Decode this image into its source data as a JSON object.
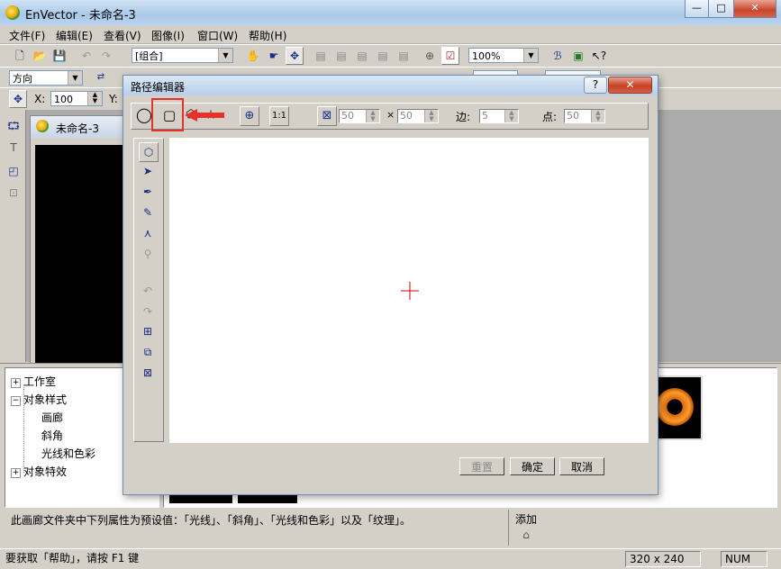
{
  "window": {
    "title": "EnVector - 未命名-3",
    "minimize": "—",
    "maximize": "□",
    "close": "✕"
  },
  "menu": [
    "文件(F)",
    "编辑(E)",
    "查看(V)",
    "图像(I)",
    "窗口(W)",
    "帮助(H)"
  ],
  "toolbar": {
    "group_combo": "[组合]",
    "zoom_combo": "100%",
    "direction_combo": "方向",
    "x_label": "X:",
    "x_value": "100",
    "y_label": "Y:"
  },
  "document": {
    "tab_title": "未命名-3"
  },
  "tree": {
    "items": [
      {
        "label": "工作室",
        "expander": "+"
      },
      {
        "label": "对象样式",
        "expander": "−"
      },
      {
        "label": "画廊"
      },
      {
        "label": "斜角"
      },
      {
        "label": "光线和色彩"
      },
      {
        "label": "对象特效",
        "expander": "+"
      }
    ]
  },
  "info": {
    "description": "此画廊文件夹中下列属性为预设值：「光线」、「斜角」、「光线和色彩」以及「纹理」。",
    "add_label": "添加"
  },
  "dialog": {
    "title": "路径编辑器",
    "help_label": "?",
    "close_label": "✕",
    "width_value": "50",
    "times_label": "×",
    "height_value": "50",
    "sides_label": "边:",
    "sides_value": "5",
    "points_label": "点:",
    "points_value": "50",
    "reset_button": "重置",
    "ok_button": "确定",
    "cancel_button": "取消",
    "fit_label": "1:1"
  },
  "status": {
    "help_text": "要获取「帮助」，请按 F1 键",
    "size": "320 x 240",
    "num": "NUM"
  },
  "colors": {
    "highlight_box": "#e8312a",
    "crosshair": "#d40000",
    "title_bar": "#b9d3ee"
  }
}
